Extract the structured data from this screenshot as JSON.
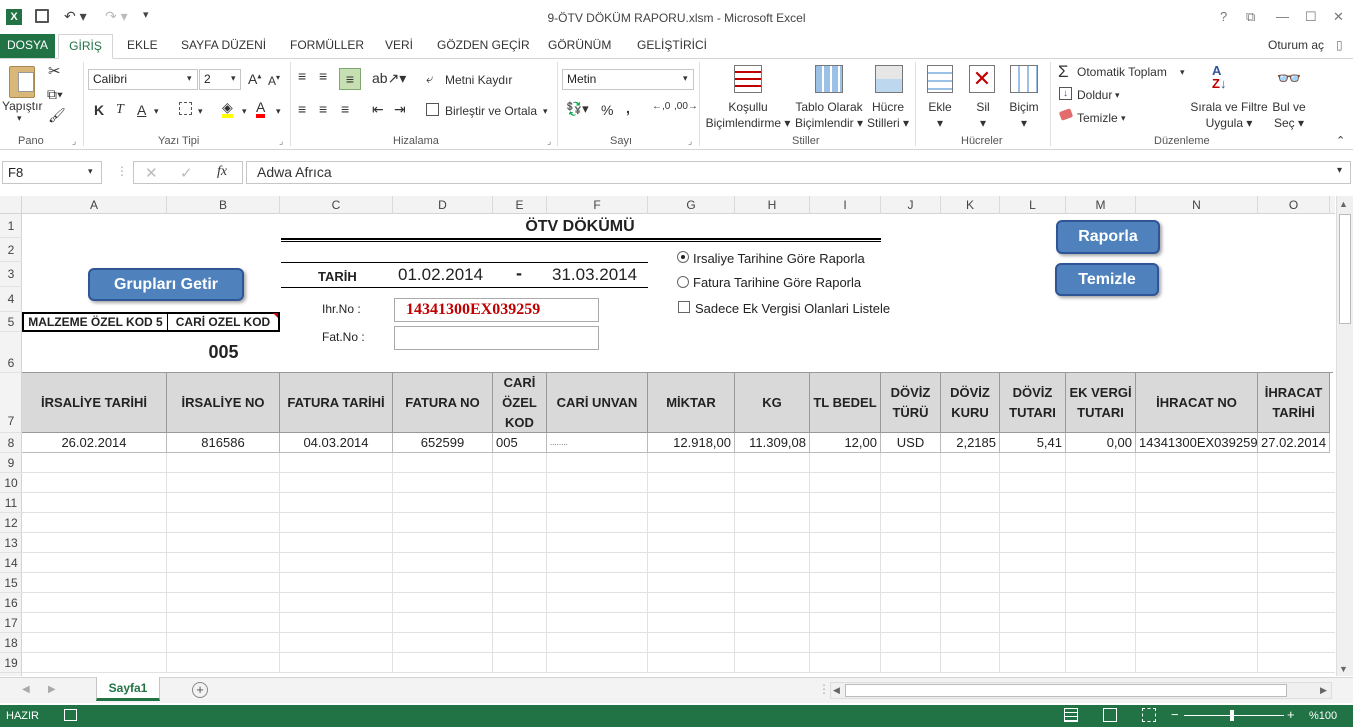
{
  "window": {
    "title": "9-ÖTV DÖKÜM RAPORU.xlsm - Microsoft Excel",
    "controls": [
      "?",
      "⧉",
      "—",
      "☐",
      "✕"
    ]
  },
  "tabs": {
    "file": "DOSYA",
    "items": [
      "GİRİŞ",
      "EKLE",
      "SAYFA DÜZENİ",
      "FORMÜLLER",
      "VERİ",
      "GÖZDEN GEÇİR",
      "GÖRÜNÜM",
      "GELİŞTİRİCİ"
    ],
    "signin": "Oturum aç"
  },
  "ribbon": {
    "clipboard": {
      "label": "Pano",
      "paste": "Yapıştır"
    },
    "font": {
      "label": "Yazı Tipi",
      "name": "Calibri",
      "size": "2"
    },
    "alignment": {
      "label": "Hizalama",
      "wrap": "Metni Kaydır",
      "merge": "Birleştir ve Ortala"
    },
    "number": {
      "label": "Sayı",
      "format": "Metin"
    },
    "styles": {
      "label": "Stiller",
      "conditional1": "Koşullu",
      "conditional2": "Biçimlendirme",
      "table1": "Tablo Olarak",
      "table2": "Biçimlendir",
      "cell1": "Hücre",
      "cell2": "Stilleri"
    },
    "cells": {
      "label": "Hücreler",
      "insert": "Ekle",
      "delete": "Sil",
      "format": "Biçim"
    },
    "editing": {
      "label": "Düzenleme",
      "autosum": "Otomatik Toplam",
      "fill": "Doldur",
      "clear": "Temizle",
      "sort1": "Sırala ve Filtre",
      "sort2": "Uygula",
      "find1": "Bul ve",
      "find2": "Seç"
    }
  },
  "formula_bar": {
    "name_box": "F8",
    "content": "Adwa Afrıca"
  },
  "columns": [
    "A",
    "B",
    "C",
    "D",
    "E",
    "F",
    "G",
    "H",
    "I",
    "J",
    "K",
    "L",
    "M",
    "N",
    "O"
  ],
  "rows": [
    "1",
    "2",
    "3",
    "4",
    "5",
    "6",
    "7",
    "8",
    "9",
    "10",
    "11",
    "12",
    "13",
    "14",
    "15",
    "16",
    "17",
    "18",
    "19"
  ],
  "sheet": {
    "title": "ÖTV DÖKÜMÜ",
    "tarih_label": "TARİH",
    "date_from": "01.02.2014",
    "date_sep": "-",
    "date_to": "31.03.2014",
    "ihr_label": "Ihr.No :",
    "ihr_value": "14341300EX039259",
    "fat_label": "Fat.No :",
    "fat_value": "",
    "radio1": "Irsaliye Tarihine Göre Raporla",
    "radio2": "Fatura Tarihine Göre Raporla",
    "checkbox": "Sadece Ek Vergisi Olanlari Listele",
    "btn_groups": "Grupları Getir",
    "btn_report": "Raporla",
    "btn_clear": "Temizle",
    "kod5_label": "MALZEME ÖZEL KOD 5",
    "cari_label": "CARİ OZEL KOD",
    "cari_value": "005"
  },
  "table": {
    "headers": [
      "İRSALİYE TARİHİ",
      "İRSALİYE NO",
      "FATURA TARİHİ",
      "FATURA NO",
      "CARİ ÖZEL KOD",
      "CARİ UNVAN",
      "MİKTAR",
      "KG",
      "TL  BEDEL",
      "DÖVİZ TÜRÜ",
      "DÖVİZ KURU",
      "DÖVİZ TUTARI",
      "EK VERGİ TUTARI",
      "İHRACAT NO",
      "İHRACAT TARİHİ"
    ],
    "rows": [
      [
        "26.02.2014",
        "816586",
        "04.03.2014",
        "652599",
        "005",
        "........",
        "12.918,00",
        "11.309,08",
        "12,00",
        "USD",
        "2,2185",
        "5,41",
        "0,00",
        "14341300EX039259",
        "27.02.2014"
      ]
    ]
  },
  "sheet_tabs": {
    "active": "Sayfa1",
    "add": "+"
  },
  "status": {
    "ready": "HAZIR",
    "zoom": "%100"
  },
  "colors": {
    "excel_green": "#217346",
    "button_blue": "#4f81bd",
    "header_gray": "#d9d9d9",
    "ihr_red": "#c00000"
  }
}
